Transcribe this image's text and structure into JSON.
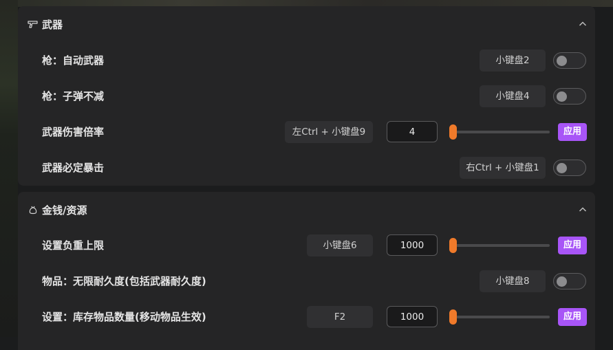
{
  "sections": [
    {
      "title": "武器",
      "icon": "gun-icon",
      "rows": [
        {
          "label": "枪：自动武器",
          "hotkey": "小键盘2",
          "toggle_on": false
        },
        {
          "label": "枪：子弹不减",
          "hotkey": "小键盘4",
          "toggle_on": false
        },
        {
          "label": "武器伤害倍率",
          "hotkey": "左Ctrl + 小键盘9",
          "value": "4",
          "slider_level": 0,
          "apply_label": "应用"
        },
        {
          "label": "武器必定暴击",
          "hotkey": "右Ctrl + 小键盘1",
          "toggle_on": false
        }
      ]
    },
    {
      "title": "金钱/资源",
      "icon": "money-bag-icon",
      "rows": [
        {
          "label": "设置负重上限",
          "hotkey": "小键盘6",
          "value": "1000",
          "slider_level": 0,
          "apply_label": "应用"
        },
        {
          "label": "物品：无限耐久度(包括武器耐久度)",
          "hotkey": "小键盘8",
          "toggle_on": false
        },
        {
          "label": "设置：库存物品数量(移动物品生效)",
          "hotkey": "F2",
          "value": "1000",
          "slider_level": 0,
          "apply_label": "应用"
        }
      ]
    }
  ],
  "colors": {
    "accent_slider": "#f07a2a",
    "apply_button": "#a855f7",
    "panel_bg": "#252526"
  }
}
